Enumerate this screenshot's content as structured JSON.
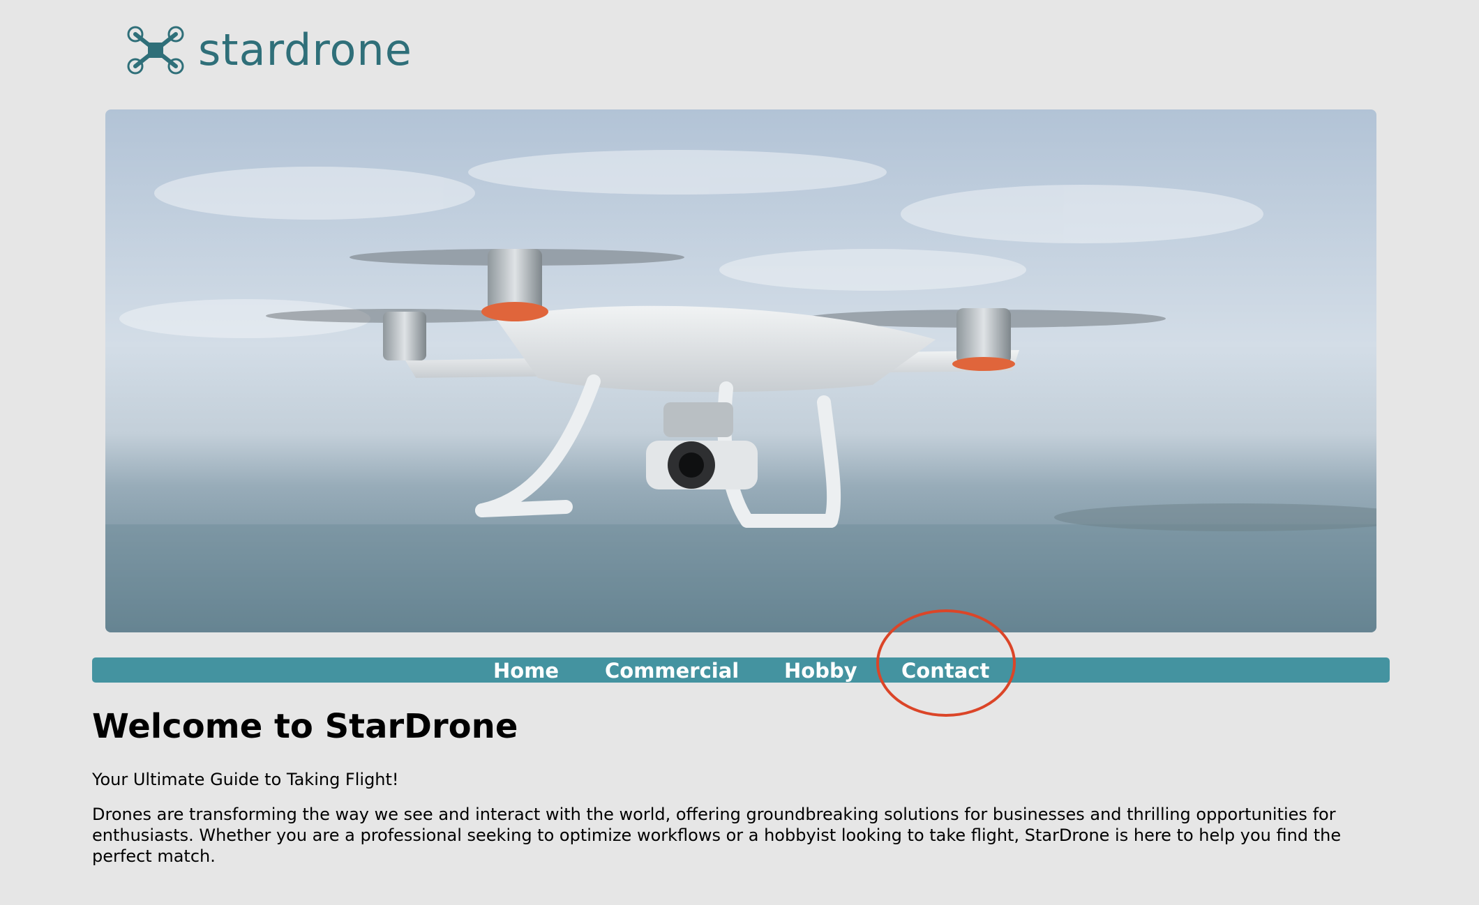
{
  "brand": {
    "name": "stardrone",
    "logo_icon": "drone-icon",
    "color": "#2f6f79"
  },
  "hero": {
    "image": "drone-hero-image"
  },
  "nav": {
    "background": "#4493a0",
    "items": [
      {
        "label": "Home"
      },
      {
        "label": "Commercial"
      },
      {
        "label": "Hobby"
      },
      {
        "label": "Contact"
      }
    ]
  },
  "annotation": {
    "highlight": "circle around Contact",
    "color": "#db4528"
  },
  "main": {
    "title": "Welcome to StarDrone",
    "tagline": "Your Ultimate Guide to Taking Flight!",
    "intro": "Drones are transforming the way we see and interact with the world, offering groundbreaking solutions for businesses and thrilling opportunities for enthusiasts. Whether you are a professional seeking to optimize workflows or a hobbyist looking to take flight, StarDrone is here to help you find the perfect match."
  }
}
